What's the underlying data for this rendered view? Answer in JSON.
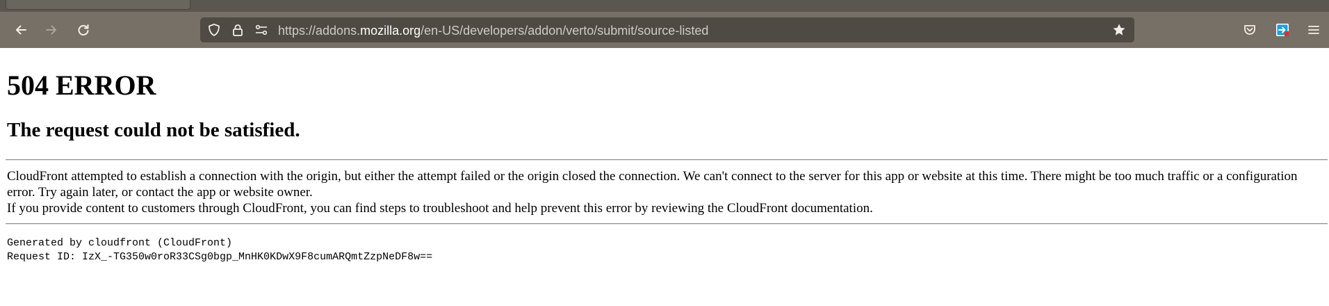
{
  "browser": {
    "url_prefix": "https://addons.",
    "url_host": "mozilla.org",
    "url_path": "/en-US/developers/addon/verto/submit/source-listed",
    "icons": {
      "back": "arrow-left-icon",
      "forward": "arrow-right-icon",
      "reload": "reload-icon",
      "shield": "tracking-protection-shield-icon",
      "lock": "lock-icon",
      "permissions": "permissions-sliders-icon",
      "bookmark": "star-icon",
      "pocket": "pocket-icon",
      "extension": "extension-icon",
      "menu": "hamburger-menu-icon"
    },
    "colors": {
      "toolbar": "#777067",
      "urlbar": "#4f4a43",
      "extension_accent": "#1aa0e0"
    }
  },
  "page": {
    "title": "504 ERROR",
    "subtitle": "The request could not be satisfied.",
    "paragraph1": "CloudFront attempted to establish a connection with the origin, but either the attempt failed or the origin closed the connection. We can't connect to the server for this app or website at this time. There might be too much traffic or a configuration error. Try again later, or contact the app or website owner.",
    "paragraph2": "If you provide content to customers through CloudFront, you can find steps to troubleshoot and help prevent this error by reviewing the CloudFront documentation.",
    "generated_by": "Generated by cloudfront (CloudFront)",
    "request_id": "Request ID: IzX_-TG350w0roR33CSg0bgp_MnHK0KDwX9F8cumARQmtZzpNeDF8w=="
  }
}
